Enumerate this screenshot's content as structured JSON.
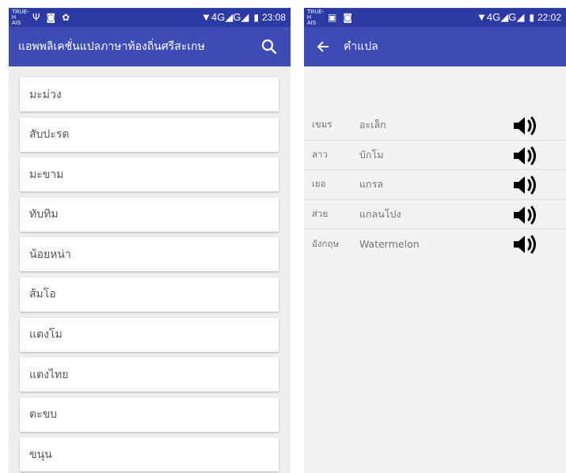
{
  "left_screen": {
    "status": {
      "carrier_line1": "TRUE-H",
      "carrier_line2": "AIS",
      "signal": "▼4G◢G◢",
      "time": "23:08"
    },
    "app_title": "แอพพลิเคชั่นแปลภาษาท้องถิ่นศรีสะเกษ",
    "words": [
      "มะม่วง",
      "สับปะรด",
      "มะขาม",
      "ทับทิม",
      "น้อยหน่า",
      "ส้มโอ",
      "แตงโม",
      "แตงไทย",
      "ตะขบ",
      "ขนุน"
    ]
  },
  "right_screen": {
    "status": {
      "carrier_line1": "TRUE-H",
      "carrier_line2": "AIS",
      "signal": "▼4G◢G◢",
      "time": "22:02"
    },
    "app_title": "คำแปล",
    "translations": [
      {
        "lang": "เขมร",
        "word": "อะเล็ก"
      },
      {
        "lang": "ลาว",
        "word": "บักโม"
      },
      {
        "lang": "เยอ",
        "word": "แกรล"
      },
      {
        "lang": "ส่วย",
        "word": "แกลนโปง"
      },
      {
        "lang": "อังกฤษ",
        "word": "Watermelon"
      }
    ]
  },
  "colors": {
    "status_bar": "#2c3aa6",
    "app_bar": "#3d4db5",
    "card_bg": "#ffffff",
    "list_bg": "#eeeeee"
  },
  "icons": {
    "search": "search-icon",
    "back": "back-arrow-icon",
    "speaker": "speaker-icon"
  }
}
